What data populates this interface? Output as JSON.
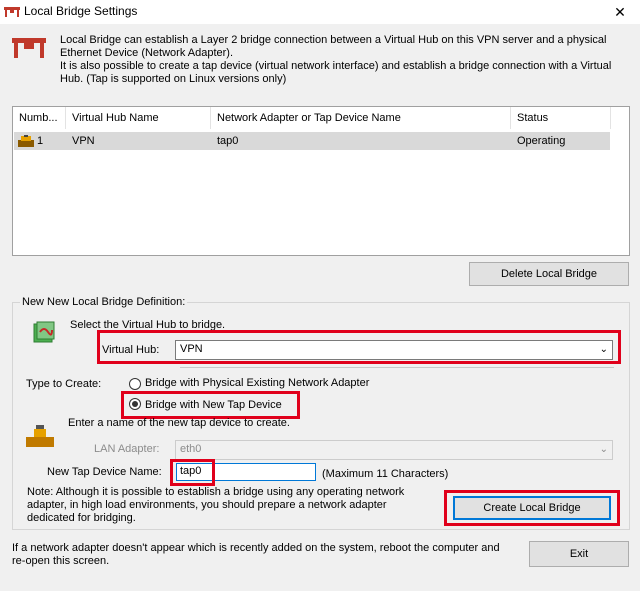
{
  "window": {
    "title": "Local Bridge Settings",
    "close_glyph": "✕"
  },
  "description": "Local Bridge can establish a Layer 2 bridge connection between a Virtual Hub on this VPN server and a physical Ethernet Device (Network Adapter).\nIt is also possible to create a tap device (virtual network interface) and establish a bridge connection with a Virtual Hub. (Tap is supported on Linux versions only)",
  "table": {
    "columns": [
      "Numb...",
      "Virtual Hub Name",
      "Network Adapter or Tap Device Name",
      "Status"
    ],
    "rows": [
      {
        "number": "1",
        "hub": "VPN",
        "adapter": "tap0",
        "status": "Operating"
      }
    ]
  },
  "delete_button": "Delete Local Bridge",
  "group": {
    "label": "New New Local Bridge Definition:",
    "select_hub_text": "Select the Virtual Hub to bridge.",
    "virtual_hub_label": "Virtual Hub:",
    "virtual_hub_value": "VPN",
    "type_label": "Type to Create:",
    "option_physical": "Bridge with Physical Existing Network Adapter",
    "option_tap": "Bridge with New Tap Device",
    "tap_instruction": "Enter a name of the new tap device to create.",
    "lan_adapter_label": "LAN Adapter:",
    "lan_adapter_value": "eth0",
    "tap_name_label": "New Tap Device Name:",
    "tap_name_value": "tap0",
    "tap_name_hint": "(Maximum 11 Characters)",
    "note": "Note: Although it is possible to establish a bridge using any operating network adapter, in high load environments, you should prepare a network adapter dedicated for bridging.",
    "create_button": "Create Local Bridge"
  },
  "footer_text": "If a network adapter doesn't appear which is recently added on the system, reboot the computer and re-open this screen.",
  "exit_button": "Exit",
  "colors": {
    "highlight": "#e0001b",
    "focus": "#0078d7"
  }
}
